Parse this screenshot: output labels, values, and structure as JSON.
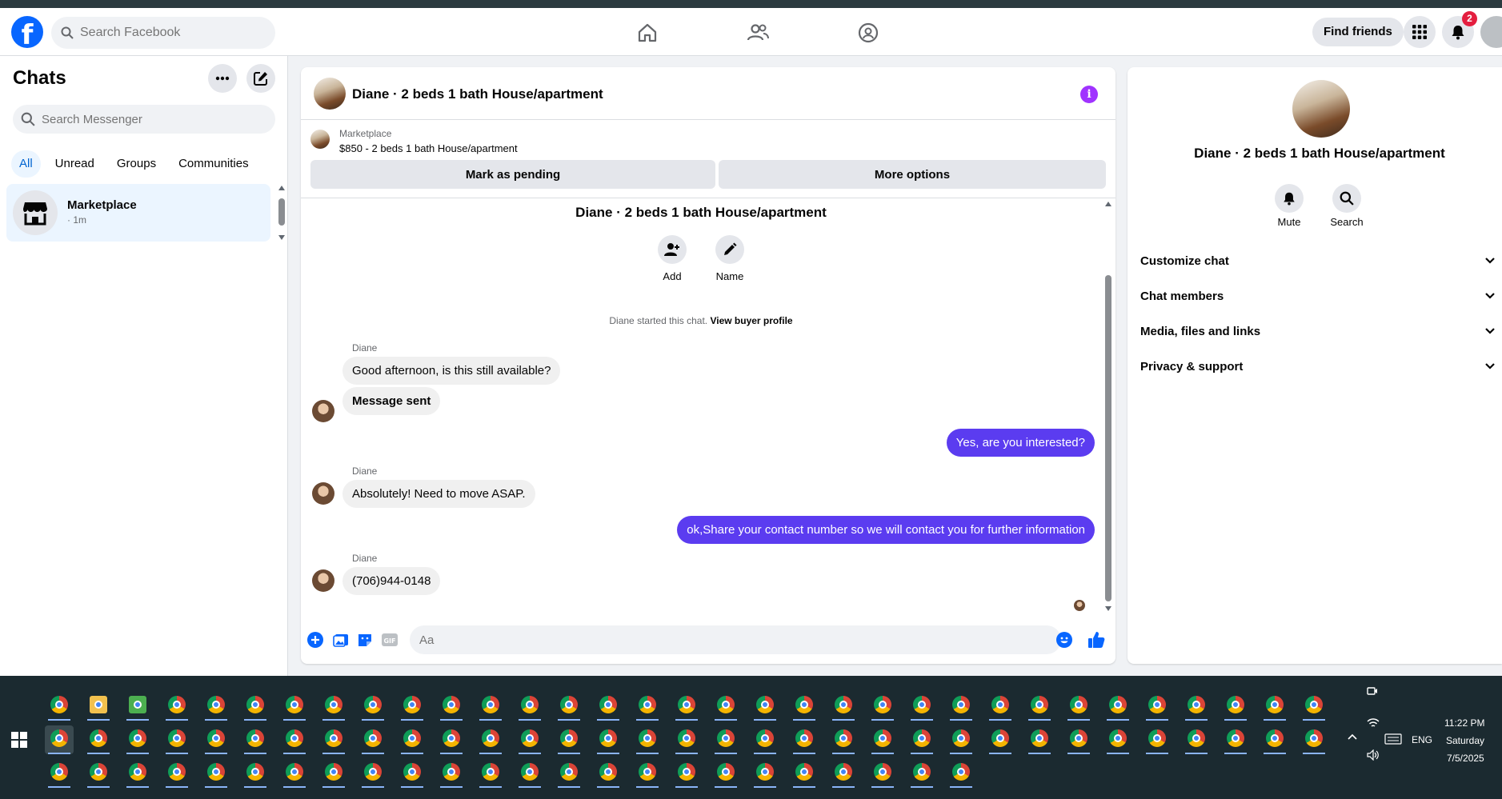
{
  "topnav": {
    "search_placeholder": "Search Facebook",
    "find_friends_label": "Find friends",
    "notification_count": "2"
  },
  "left": {
    "title": "Chats",
    "search_placeholder": "Search Messenger",
    "filters": [
      "All",
      "Unread",
      "Groups",
      "Communities"
    ],
    "active_filter": "All",
    "chat": {
      "name": "Marketplace",
      "time": "· 1m"
    }
  },
  "conversation": {
    "title": "Diane · 2 beds 1 bath House/apartment",
    "marketplace_label": "Marketplace",
    "listing": "$850 - 2 beds 1 bath House/apartment",
    "mark_pending_label": "Mark as pending",
    "more_options_label": "More options",
    "center_title": "Diane · 2 beds 1 bath House/apartment",
    "add_label": "Add",
    "name_label": "Name",
    "started_text": "Diane started this chat.",
    "view_buyer_profile": "View buyer profile",
    "messages": [
      {
        "from": "them",
        "sender": "Diane",
        "text": "Good afternoon, is this still available?"
      },
      {
        "from": "them",
        "text": "Message sent"
      },
      {
        "from": "me",
        "text": "Yes, are you interested?"
      },
      {
        "from": "them",
        "sender": "Diane",
        "text": "Absolutely! Need to move ASAP."
      },
      {
        "from": "me",
        "text": "ok,Share your contact number so we will contact you for further information"
      },
      {
        "from": "them",
        "sender": "Diane",
        "text": "(706)944-0148"
      }
    ],
    "composer_placeholder": "Aa"
  },
  "right": {
    "name": "Diane · 2 beds 1 bath House/apartment",
    "mute_label": "Mute",
    "search_label": "Search",
    "sections": [
      "Customize chat",
      "Chat members",
      "Media, files and links",
      "Privacy & support"
    ]
  },
  "taskbar": {
    "time": "11:22 PM",
    "day": "Saturday",
    "date": "7/5/2025",
    "language": "ENG"
  },
  "colors": {
    "brand_blue": "#0866ff",
    "outgoing_bubble": "#5b3cf0",
    "info_purple": "#a033ff",
    "active_chat_bg": "#ebf5ff",
    "badge_red": "#e41e3f"
  }
}
